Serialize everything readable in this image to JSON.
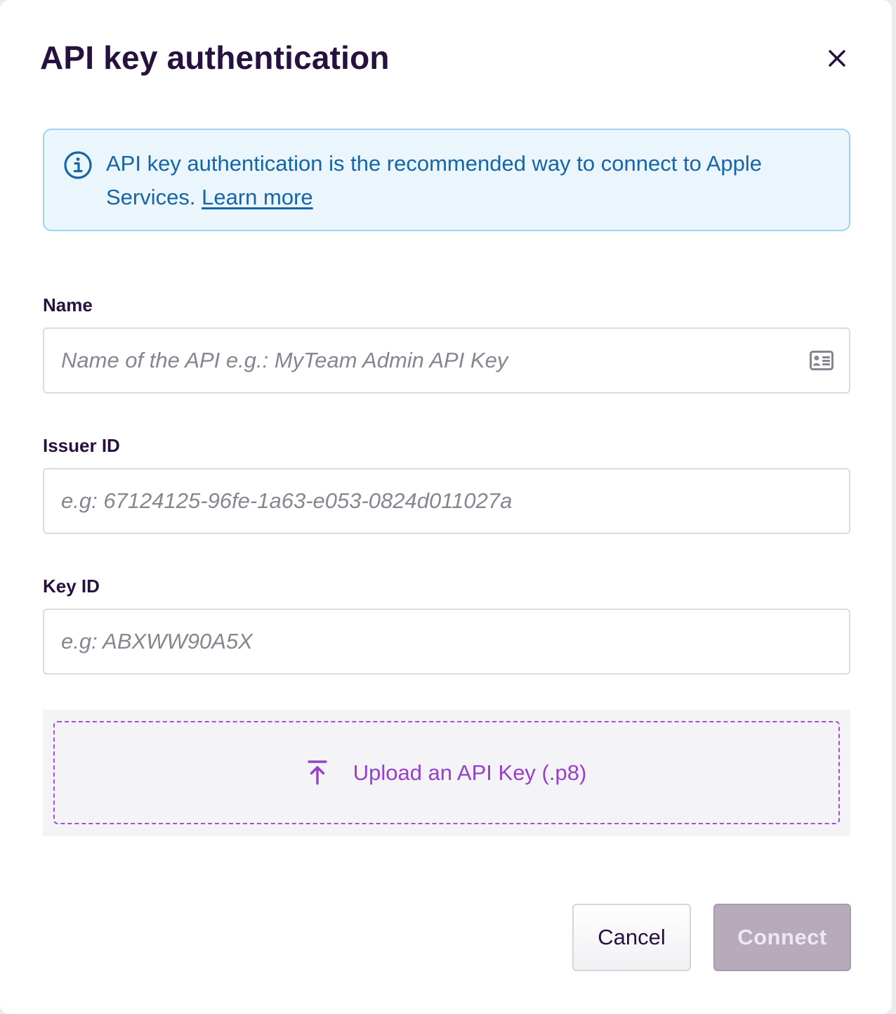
{
  "dialog": {
    "title": "API key authentication",
    "close_icon": "close-icon"
  },
  "info": {
    "icon": "info-icon",
    "text": "API key authentication is the recommended way to connect to Apple Services. ",
    "link_label": "Learn more",
    "accent_color": "#1565a8",
    "background_color": "#eaf6fc"
  },
  "fields": {
    "name": {
      "label": "Name",
      "value": "",
      "placeholder": "Name of the API e.g.: MyTeam Admin API Key",
      "icon": "contact-card-icon"
    },
    "issuer_id": {
      "label": "Issuer ID",
      "value": "",
      "placeholder": "e.g: 67124125-96fe-1a63-e053-0824d011027a"
    },
    "key_id": {
      "label": "Key ID",
      "value": "",
      "placeholder": "e.g: ABXWW90A5X"
    }
  },
  "upload": {
    "icon": "upload-icon",
    "label": "Upload an API Key (.p8)",
    "accent_color": "#9740c9"
  },
  "actions": {
    "cancel_label": "Cancel",
    "connect_label": "Connect",
    "connect_disabled": true
  }
}
